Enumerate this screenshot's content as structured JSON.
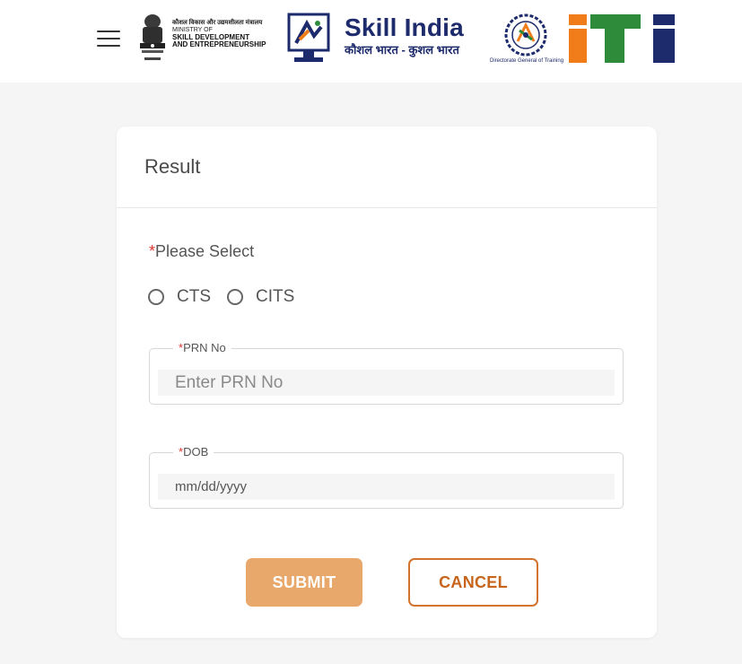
{
  "header": {
    "ministry": {
      "hindi_line": "कौशल विकास और उद्यमशीलता मंत्रालय",
      "line1": "MINISTRY OF",
      "line2": "SKILL DEVELOPMENT",
      "line3": "AND ENTREPRENEURSHIP"
    },
    "skill_india": {
      "title": "Skill India",
      "tagline": "कौशल भारत - कुशल भारत"
    },
    "dgt_caption": "Directorate General of Training",
    "iti_logo_text": "iti"
  },
  "card": {
    "title": "Result",
    "select_label": "Please Select",
    "required_mark": "*",
    "radio_options": [
      {
        "label": "CTS",
        "selected": false
      },
      {
        "label": "CITS",
        "selected": false
      }
    ],
    "prn_field": {
      "label": "PRN No",
      "placeholder": "Enter PRN No",
      "value": ""
    },
    "dob_field": {
      "label": "DOB",
      "placeholder": "mm/dd/yyyy"
    },
    "submit_label": "SUBMIT",
    "cancel_label": "CANCEL"
  },
  "colors": {
    "submit_bg": "#e9a86b",
    "cancel_text": "#c8651c",
    "required": "#d9342b",
    "brand_navy": "#1d2a6b",
    "iti_orange": "#f07d1a",
    "iti_green": "#2e8b3a"
  }
}
